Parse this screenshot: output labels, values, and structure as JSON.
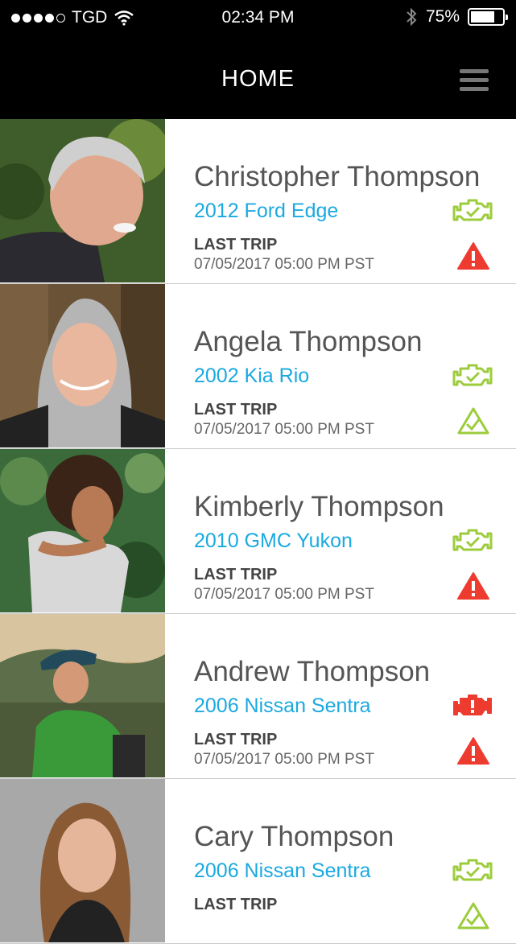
{
  "status_bar": {
    "carrier": "TGD",
    "time": "02:34 PM",
    "battery": "75%",
    "battery_level": 0.75,
    "signal_bars_filled": 4,
    "signal_bars_total": 5
  },
  "nav": {
    "title": "HOME",
    "menu_icon": "hamburger-menu-icon"
  },
  "colors": {
    "accent_blue": "#1ba9e0",
    "ok_green": "#9ccc3c",
    "alert_red": "#ee3b30",
    "nav_bg": "#000000"
  },
  "trip_label": "LAST TRIP",
  "drivers": [
    {
      "name": "Christopher Thompson",
      "vehicle": "2012 Ford Edge",
      "trip_date": "07/05/2017 05:00 PM PST",
      "engine_status": "ok",
      "alert_status": "warning"
    },
    {
      "name": "Angela Thompson",
      "vehicle": "2002 Kia Rio",
      "trip_date": "07/05/2017 05:00 PM PST",
      "engine_status": "ok",
      "alert_status": "ok"
    },
    {
      "name": "Kimberly Thompson",
      "vehicle": "2010 GMC Yukon",
      "trip_date": "07/05/2017 05:00 PM PST",
      "engine_status": "ok",
      "alert_status": "warning"
    },
    {
      "name": "Andrew Thompson",
      "vehicle": "2006 Nissan Sentra",
      "trip_date": "07/05/2017 05:00 PM PST",
      "engine_status": "warning",
      "alert_status": "warning"
    },
    {
      "name": "Cary Thompson",
      "vehicle": "2006 Nissan Sentra",
      "trip_date": "",
      "engine_status": "ok",
      "alert_status": "ok"
    }
  ]
}
